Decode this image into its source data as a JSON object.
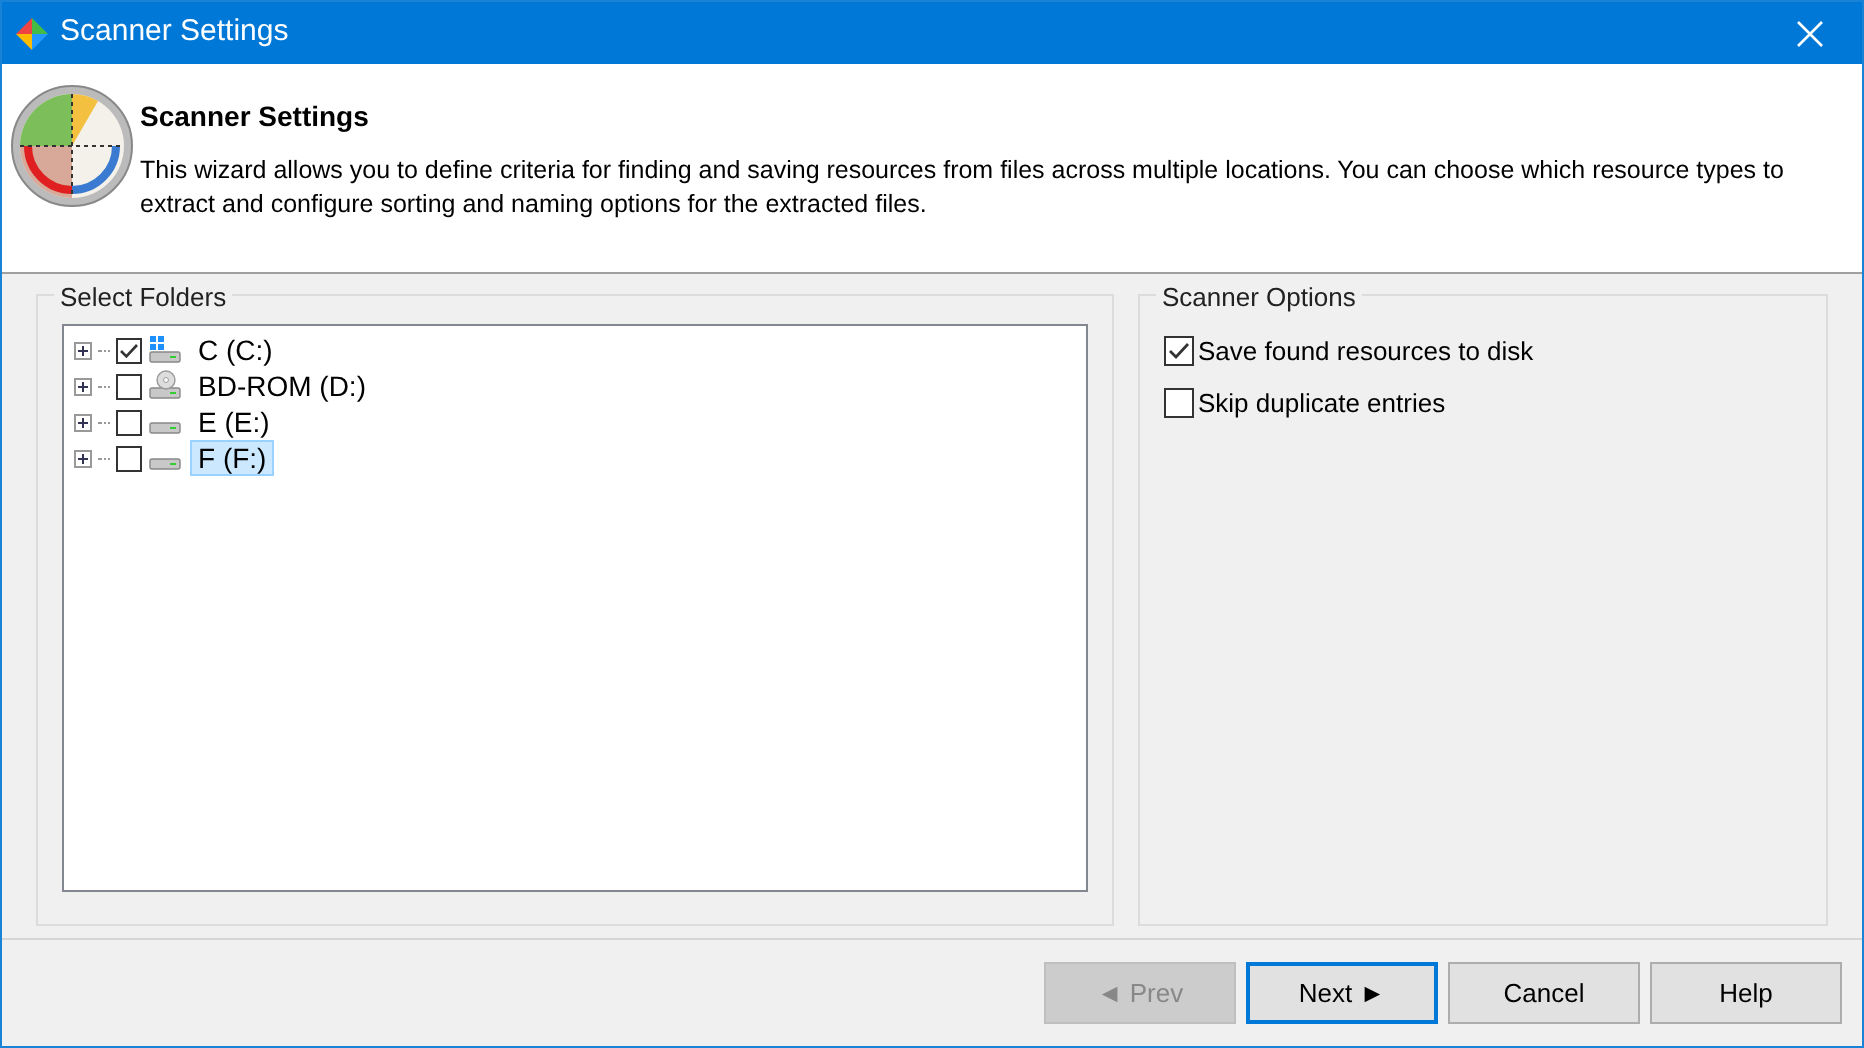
{
  "window": {
    "title": "Scanner Settings"
  },
  "header": {
    "title": "Scanner Settings",
    "description": "This wizard allows you to define criteria for finding and saving resources from files across multiple locations. You can choose which resource types to extract and configure sorting and naming options for the extracted files."
  },
  "folders": {
    "title": "Select Folders",
    "items": [
      {
        "label": "C (C:)",
        "kind": "system",
        "checked": true,
        "selected": false
      },
      {
        "label": "BD-ROM (D:)",
        "kind": "optical",
        "checked": false,
        "selected": false
      },
      {
        "label": "E (E:)",
        "kind": "disk",
        "checked": false,
        "selected": false
      },
      {
        "label": "F (F:)",
        "kind": "disk",
        "checked": false,
        "selected": true
      }
    ]
  },
  "options": {
    "title": "Scanner Options",
    "items": [
      {
        "label": "Save found resources to disk",
        "checked": true
      },
      {
        "label": "Skip duplicate entries",
        "checked": false
      }
    ]
  },
  "buttons": [
    {
      "label": "◄ Prev",
      "disabled": true,
      "default": false
    },
    {
      "label": "Next ►",
      "disabled": false,
      "default": true
    },
    {
      "label": "Cancel",
      "disabled": false,
      "default": false
    },
    {
      "label": "Help",
      "disabled": false,
      "default": false
    }
  ]
}
